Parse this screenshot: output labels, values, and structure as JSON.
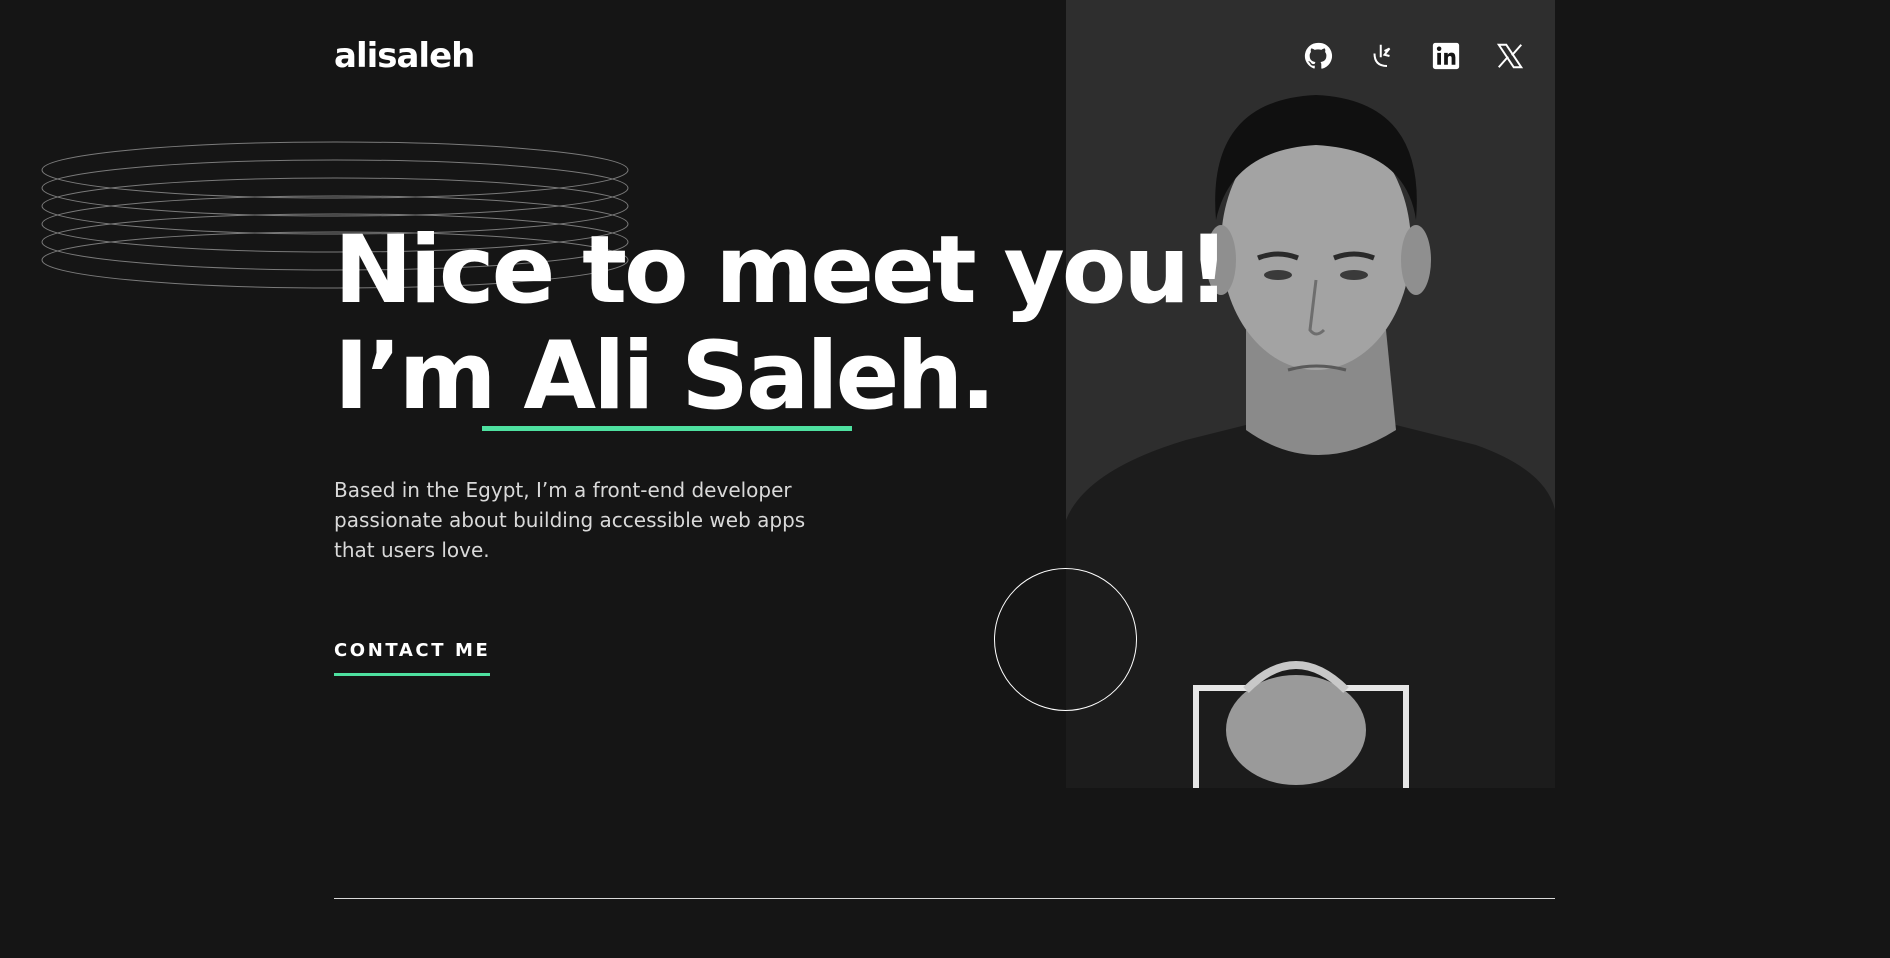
{
  "header": {
    "logo": "alisaleh",
    "socials": [
      {
        "name": "github-icon"
      },
      {
        "name": "leetcode-icon"
      },
      {
        "name": "linkedin-icon"
      },
      {
        "name": "x-icon"
      }
    ]
  },
  "hero": {
    "title_line1": "Nice to meet you!",
    "title_prefix": "I’m ",
    "title_name": "Ali Saleh",
    "title_suffix": ".",
    "intro": "Based in the Egypt, I’m a front-end developer passionate about building accessible web apps that users love.",
    "cta_label": "CONTACT ME"
  },
  "colors": {
    "background": "#151515",
    "accent": "#4ee1a0",
    "text": "#ffffff",
    "body_text": "#d9d9d9"
  }
}
